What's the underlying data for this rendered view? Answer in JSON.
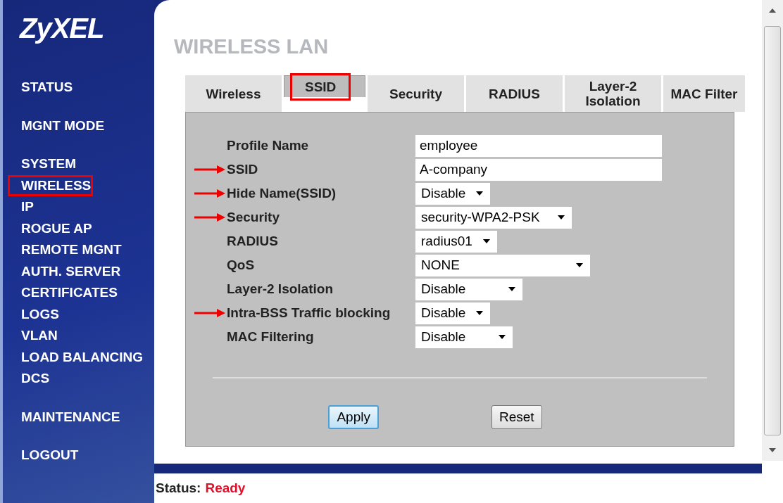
{
  "logo": "ZyXEL",
  "nav_groups": [
    [
      {
        "label": "STATUS",
        "highlighted": false
      }
    ],
    [
      {
        "label": "MGNT MODE",
        "highlighted": false
      }
    ],
    [
      {
        "label": "SYSTEM",
        "highlighted": false
      },
      {
        "label": "WIRELESS",
        "highlighted": true
      },
      {
        "label": "IP",
        "highlighted": false
      },
      {
        "label": "ROGUE AP",
        "highlighted": false
      },
      {
        "label": "REMOTE MGNT",
        "highlighted": false
      },
      {
        "label": "AUTH. SERVER",
        "highlighted": false
      },
      {
        "label": "CERTIFICATES",
        "highlighted": false
      },
      {
        "label": "LOGS",
        "highlighted": false
      },
      {
        "label": "VLAN",
        "highlighted": false
      },
      {
        "label": "LOAD BALANCING",
        "highlighted": false
      },
      {
        "label": "DCS",
        "highlighted": false
      }
    ],
    [
      {
        "label": "MAINTENANCE",
        "highlighted": false
      }
    ],
    [
      {
        "label": "LOGOUT",
        "highlighted": false
      }
    ]
  ],
  "page_title": "WIRELESS LAN",
  "tabs": [
    {
      "label": "Wireless",
      "selected": false,
      "highlighted": false
    },
    {
      "label": "SSID",
      "selected": true,
      "highlighted": true
    },
    {
      "label": "Security",
      "selected": false,
      "highlighted": false
    },
    {
      "label": "RADIUS",
      "selected": false,
      "highlighted": false
    },
    {
      "label": "Layer-2 Isolation",
      "selected": false,
      "highlighted": false
    },
    {
      "label": "MAC Filter",
      "selected": false,
      "highlighted": false
    }
  ],
  "fields": [
    {
      "label": "Profile Name",
      "kind": "text",
      "value": "employee",
      "arrow": false
    },
    {
      "label": "SSID",
      "kind": "text",
      "value": "A-company",
      "arrow": true
    },
    {
      "label": "Hide Name(SSID)",
      "kind": "select",
      "value": "Disable",
      "arrow": true
    },
    {
      "label": "Security",
      "kind": "select",
      "value": "security-WPA2-PSK",
      "arrow": true
    },
    {
      "label": "RADIUS",
      "kind": "select",
      "value": "radius01",
      "arrow": false
    },
    {
      "label": "QoS",
      "kind": "select",
      "value": "NONE",
      "arrow": false
    },
    {
      "label": "Layer-2 Isolation",
      "kind": "select",
      "value": "Disable",
      "arrow": false
    },
    {
      "label": "Intra-BSS Traffic blocking",
      "kind": "select",
      "value": "Disable",
      "arrow": true
    },
    {
      "label": "MAC Filtering",
      "kind": "select",
      "value": "Disable",
      "arrow": false
    }
  ],
  "buttons": [
    {
      "label": "Apply",
      "focused": true
    },
    {
      "label": "Reset",
      "focused": false
    }
  ],
  "status": {
    "label": "Status:",
    "value": "Ready"
  }
}
